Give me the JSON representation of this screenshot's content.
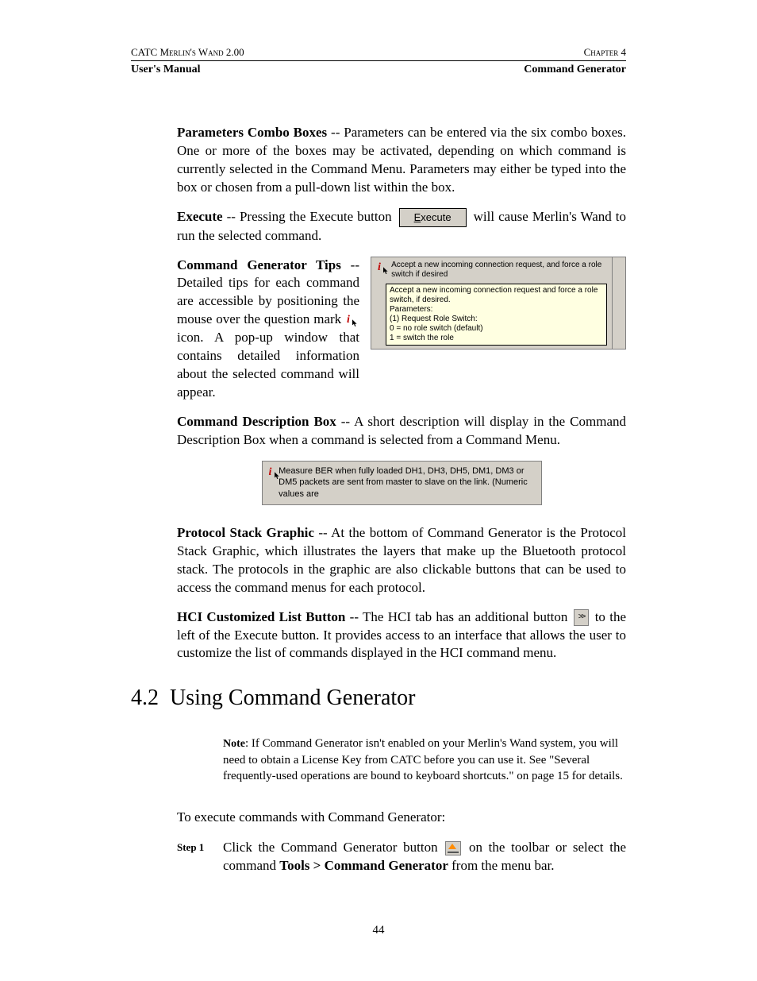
{
  "header": {
    "product": "CATC Merlin's Wand 2.00",
    "chapter": "Chapter 4",
    "left": "User's Manual",
    "right": "Command Generator"
  },
  "para1": {
    "label": "Parameters Combo Boxes",
    "text": " -- Parameters can be entered via the six combo boxes. One or more of the boxes may be activated, depending on which command is currently selected in the Command Menu. Parameters may either be typed into the box or chosen from a pull-down list within the box."
  },
  "para2": {
    "label": "Execute",
    "before": " -- Pressing the Execute button ",
    "btn_letter": "E",
    "btn_rest": "xecute",
    "after": " will cause Merlin's Wand to run the selected command."
  },
  "tips": {
    "label": "Command Generator Tips",
    "before": " -- Detailed tips for each command are accessible by positioning the mouse over the question mark ",
    "after": " icon. A pop-up window that contains detailed information about the selected command will appear.",
    "panel_top": "Accept a new incoming connection request, and force a role switch if desired",
    "panel_body": "Accept a new incoming connection request and force a role switch, if desired.\n Parameters:\n(1) Request Role Switch:\n       0 = no role switch (default)\n       1 = switch the role"
  },
  "cmddesc": {
    "label": "Command Description Box",
    "text": " -- A short description will display in the Command Description Box when a command is selected from a Command Menu.",
    "box_text": "Measure BER when fully loaded DH1, DH3, DH5, DM1, DM3 or DM5 packets are sent from master to slave on the link. (Numeric values are"
  },
  "proto": {
    "label": "Protocol Stack Graphic",
    "text": " -- At the bottom of Command Generator is the Protocol Stack Graphic, which illustrates the layers that make up the Bluetooth protocol stack. The protocols in the graphic are also clickable buttons that can be used to access the command menus for each protocol."
  },
  "hci": {
    "label": "HCI Customized List Button",
    "before": " -- The HCI tab has an additional button ",
    "arrow": ">>",
    "after": " to the left of the Execute button. It provides access to an interface that allows the user to customize the list of commands displayed in the HCI command menu."
  },
  "section": {
    "num": "4.2",
    "title": "Using Command Generator"
  },
  "note": {
    "label": "Note",
    "text": ": If Command Generator isn't enabled on your Merlin's Wand system, you will need to obtain a License Key from CATC before you can use it. See \"Several frequently-used operations are bound to keyboard shortcuts.\" on page 15 for details."
  },
  "intro": "To execute commands with Command Generator:",
  "step1": {
    "label": "Step 1",
    "before": "Click the Command Generator button ",
    "mid": " on the toolbar or select the command ",
    "menu": "Tools > Command Generator",
    "after": " from the menu bar."
  },
  "pagenum": "44"
}
